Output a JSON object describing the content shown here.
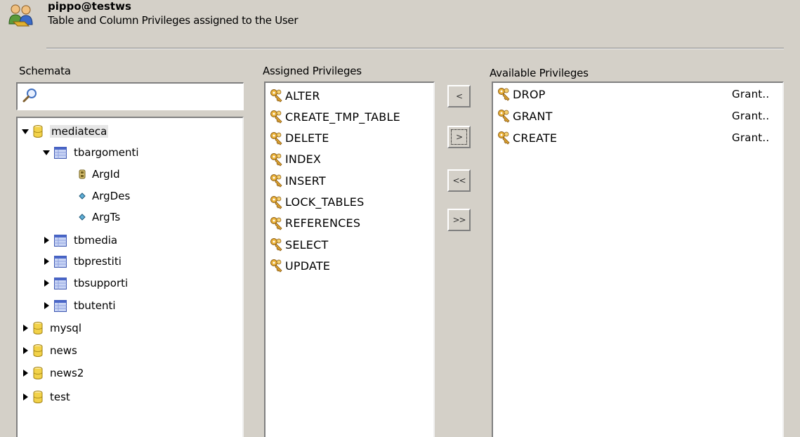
{
  "header": {
    "user": "pippo@testws",
    "description": "Table and Column Privileges assigned to the User"
  },
  "schemata": {
    "label": "Schemata",
    "search_placeholder": "",
    "tree": {
      "db_mediateca": "mediateca",
      "tbl_tbargomenti": "tbargomenti",
      "col_argid": "ArgId",
      "col_argdes": "ArgDes",
      "col_argts": "ArgTs",
      "tbl_tbmedia": "tbmedia",
      "tbl_tbprestiti": "tbprestiti",
      "tbl_tbsupporti": "tbsupporti",
      "tbl_tbutenti": "tbutenti",
      "db_mysql": "mysql",
      "db_news": "news",
      "db_news2": "news2",
      "db_test": "test"
    }
  },
  "assigned": {
    "label": "Assigned Privileges",
    "items": [
      "ALTER",
      "CREATE_TMP_TABLE",
      "DELETE",
      "INDEX",
      "INSERT",
      "LOCK_TABLES",
      "REFERENCES",
      "SELECT",
      "UPDATE"
    ]
  },
  "buttons": {
    "remove": "<",
    "add": ">",
    "remove_all": "<<",
    "add_all": ">>"
  },
  "available": {
    "label": "Available Privileges",
    "items": [
      {
        "name": "DROP",
        "grant": "Grant.."
      },
      {
        "name": "GRANT",
        "grant": "Grant.."
      },
      {
        "name": "CREATE",
        "grant": "Grant.."
      }
    ]
  },
  "colors": {
    "window_bg": "#d4d0c8",
    "list_bg": "#ffffff",
    "db_icon": "#f2d24a",
    "table_icon": "#6f86d6",
    "key_icon": "#d9a030"
  }
}
